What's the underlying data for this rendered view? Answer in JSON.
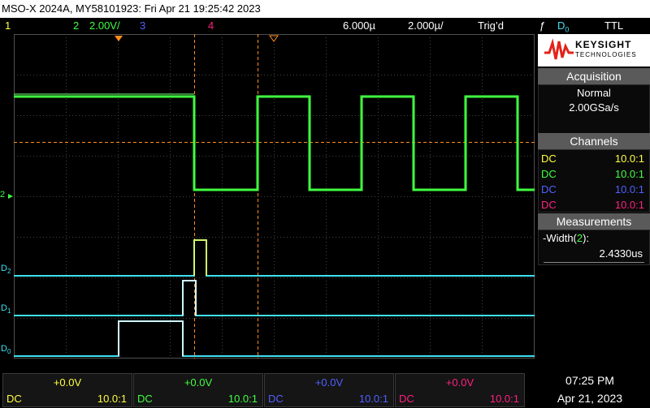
{
  "title": "MSO-X 2024A, MY58101923: Fri Apr 21 19:25:42 2023",
  "top": {
    "ch1_num": "1",
    "ch2_num": "2",
    "ch2_scale": "2.00V/",
    "ch3_num": "3",
    "ch4_num": "4",
    "delay": "6.000µ",
    "timebase": "2.000µ/",
    "trig_label": "Trig’d",
    "trig_slope": "ƒ",
    "trig_src": "D",
    "trig_src_sub": "0",
    "trig_level": "TTL"
  },
  "markers": {
    "ch2_ref": "2",
    "d2": "D",
    "d2_sub": "2",
    "d1": "D",
    "d1_sub": "1",
    "d0": "D",
    "d0_sub": "0"
  },
  "panel": {
    "logo_name": "KEYSIGHT",
    "logo_sub": "TECHNOLOGIES",
    "acquisition_header": "Acquisition",
    "acq_mode": "Normal",
    "acq_rate": "2.00GSa/s",
    "channels_header": "Channels",
    "channels": [
      {
        "coupling": "DC",
        "probe": "10.0:1",
        "color": "#ffff40"
      },
      {
        "coupling": "DC",
        "probe": "10.0:1",
        "color": "#40ff40"
      },
      {
        "coupling": "DC",
        "probe": "10.0:1",
        "color": "#5060ff"
      },
      {
        "coupling": "DC",
        "probe": "10.0:1",
        "color": "#ff2080"
      }
    ],
    "measurements_header": "Measurements",
    "meas_name": "-Width(",
    "meas_ch": "2",
    "meas_close": "):",
    "meas_value": "2.4330us"
  },
  "bottom": {
    "ch": [
      {
        "offset": "+0.0V",
        "coupling": "DC",
        "probe": "10.0:1",
        "color": "#ffff40"
      },
      {
        "offset": "+0.0V",
        "coupling": "DC",
        "probe": "10.0:1",
        "color": "#40ff40"
      },
      {
        "offset": "+0.0V",
        "coupling": "DC",
        "probe": "10.0:1",
        "color": "#5060ff"
      },
      {
        "offset": "+0.0V",
        "coupling": "DC",
        "probe": "10.0:1",
        "color": "#ff2080"
      }
    ],
    "time": "07:25 PM",
    "date": "Apr 21, 2023"
  },
  "colors": {
    "ch1": "#ffff40",
    "ch2": "#40ff40",
    "ch3": "#5060ff",
    "ch4": "#ff2080",
    "digital": "#40e0f0",
    "cursor": "#ff8c20",
    "grid": "#505050"
  }
}
